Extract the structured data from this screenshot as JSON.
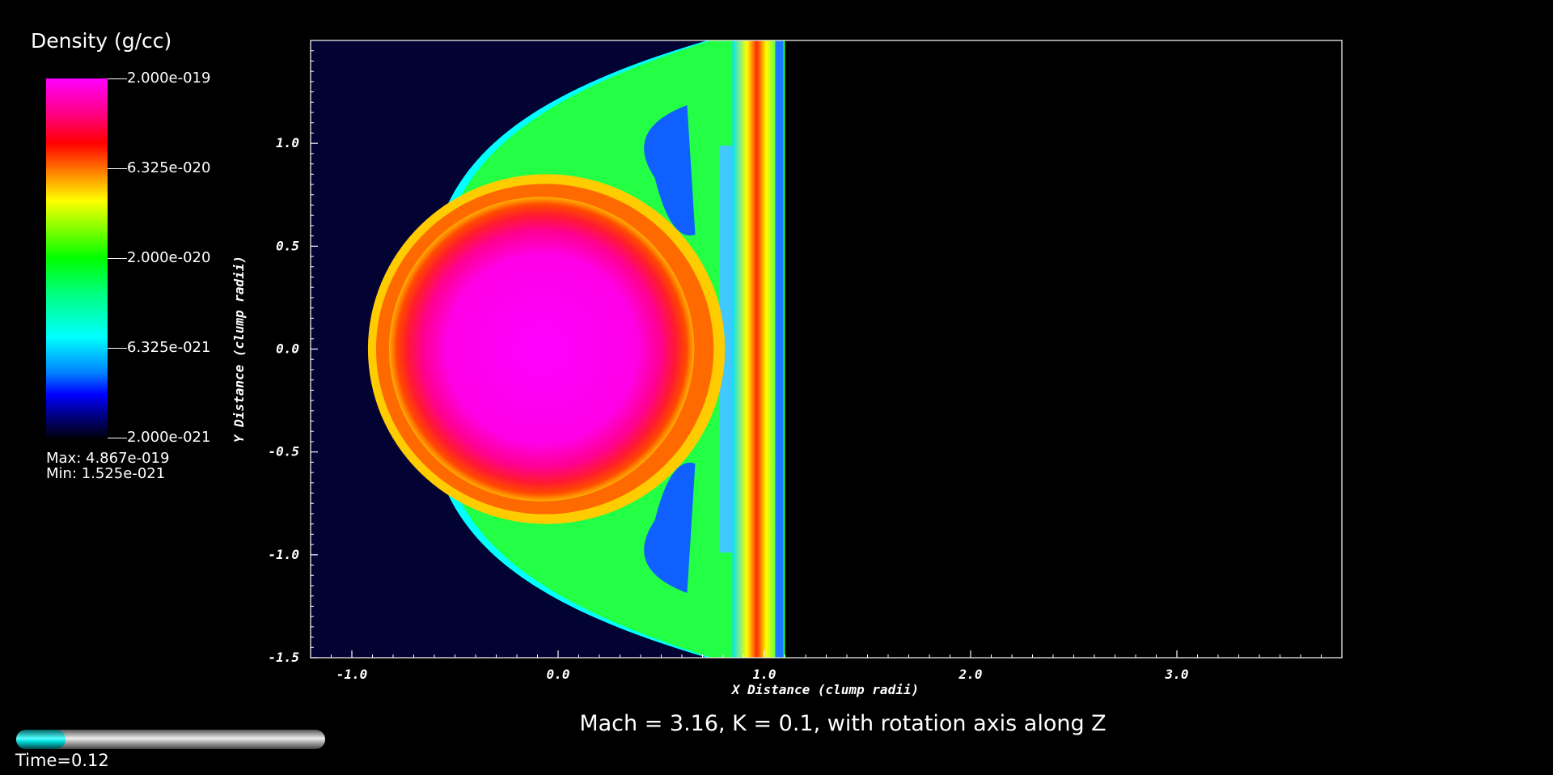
{
  "legend": {
    "title": "Density (g/cc)",
    "ticks": [
      "2.000e-019",
      "6.325e-020",
      "2.000e-020",
      "6.325e-021",
      "2.000e-021"
    ],
    "max_label": "Max:  4.867e-019",
    "min_label": "Min:  1.525e-021"
  },
  "caption": "Mach = 3.16, K = 0.1, with rotation axis along Z",
  "time": {
    "label": "Time=0.12",
    "progress": 0.16
  },
  "colors": {
    "background": "#000000",
    "domain_background": "#020233",
    "clump_core": "#ff00ff",
    "shell": "#ff1a40",
    "shock_front": "#00ffff",
    "slider_fill": "#00e5e5"
  },
  "chart_data": {
    "type": "heatmap",
    "title": "",
    "xlabel": "X Distance (clump radii)",
    "ylabel": "Y Distance (clump radii)",
    "xlim": [
      -1.2,
      3.8
    ],
    "ylim": [
      -1.5,
      1.5
    ],
    "x_ticks": [
      "-1.0",
      "0.0",
      "1.0",
      "2.0",
      "3.0"
    ],
    "x_tick_values": [
      -1.0,
      0.0,
      1.0,
      2.0,
      3.0
    ],
    "y_ticks": [
      "1.0",
      "0.5",
      "0.0",
      "-0.5",
      "-1.0",
      "-1.5"
    ],
    "y_tick_values": [
      1.0,
      0.5,
      0.0,
      -0.5,
      -1.0,
      -1.5
    ],
    "colorbar_range": [
      2e-21,
      2e-19
    ],
    "colorbar_scale": "log",
    "data_extent_x": [
      -1.2,
      1.1
    ],
    "clump_center": [
      -0.08,
      0.0
    ],
    "clump_radius": 0.74,
    "bow_shock_apex_x": -0.64,
    "shell_x": 0.9
  }
}
